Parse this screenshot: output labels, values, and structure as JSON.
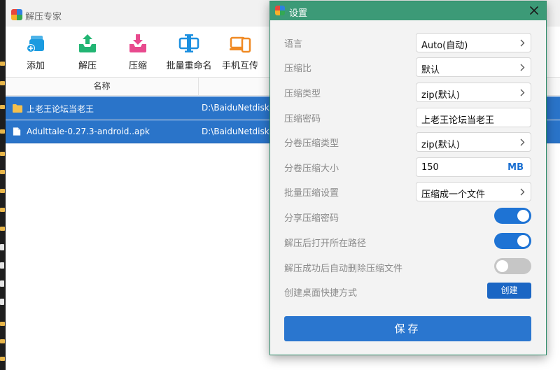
{
  "main_window": {
    "title": "解压专家",
    "toolbar": [
      {
        "label": "添加",
        "icon": "add-icon"
      },
      {
        "label": "解压",
        "icon": "extract-icon"
      },
      {
        "label": "压缩",
        "icon": "compress-icon"
      },
      {
        "label": "批量重命名",
        "icon": "batch-rename-icon"
      },
      {
        "label": "手机互传",
        "icon": "phone-transfer-icon"
      }
    ],
    "columns": {
      "name": "名称"
    },
    "files": [
      {
        "name": "上老王论坛当老王",
        "path": "D:\\BaiduNetdiskDo",
        "type": "folder"
      },
      {
        "name": "Adulttale-0.27.3-android..apk",
        "path": "D:\\BaiduNetdiskDo",
        "type": "file"
      }
    ]
  },
  "settings": {
    "title": "设置",
    "rows": [
      {
        "label": "语言",
        "value": "Auto(自动)",
        "control": "select"
      },
      {
        "label": "压缩比",
        "value": "默认",
        "control": "select"
      },
      {
        "label": "压缩类型",
        "value": "zip(默认)",
        "control": "select"
      },
      {
        "label": "压缩密码",
        "value": "上老王论坛当老王",
        "control": "input"
      },
      {
        "label": "分卷压缩类型",
        "value": "zip(默认)",
        "control": "select"
      },
      {
        "label": "分卷压缩大小",
        "value": "150",
        "unit": "MB",
        "control": "input"
      },
      {
        "label": "批量压缩设置",
        "value": "压缩成一个文件",
        "control": "select"
      },
      {
        "label": "分享压缩密码",
        "enabled": true,
        "control": "toggle"
      },
      {
        "label": "解压后打开所在路径",
        "enabled": true,
        "control": "toggle"
      },
      {
        "label": "解压成功后自动删除压缩文件",
        "enabled": false,
        "control": "toggle"
      },
      {
        "label": "创建桌面快捷方式",
        "button": "创建",
        "control": "button"
      }
    ],
    "save_label": "保存"
  },
  "colors": {
    "selection": "#2a74c9",
    "dialog_titlebar": "#3c9a77",
    "toggle_on": "#1e73d4",
    "toggle_off": "#c6c6c6",
    "primary_button": "#2a76cf"
  }
}
